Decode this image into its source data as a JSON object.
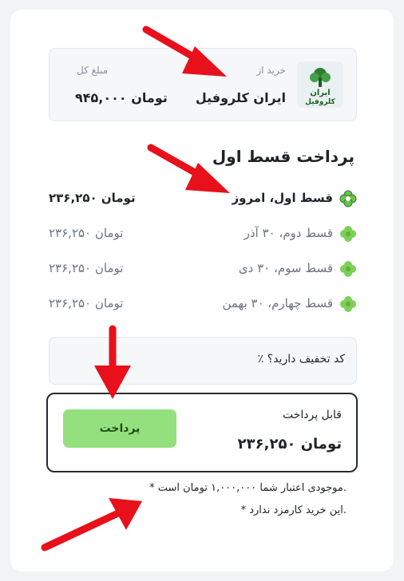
{
  "merchant": {
    "from_label": "خرید از",
    "name": "ایران کلروفیل",
    "total_label": "مبلغ کل",
    "total_amount": "۹۴۵,۰۰۰ تومان",
    "logo_text_top": "ایران",
    "logo_text_bottom": "کلروفیل"
  },
  "section_title": "پرداخت قسط اول",
  "installments": [
    {
      "label": "قسط اول، امروز",
      "amount": "۲۳۶,۲۵۰ تومان"
    },
    {
      "label": "قسط دوم، ۳۰ آذر",
      "amount": "۲۳۶,۲۵۰ تومان"
    },
    {
      "label": "قسط سوم، ۳۰ دی",
      "amount": "۲۳۶,۲۵۰ تومان"
    },
    {
      "label": "قسط چهارم، ۳۰ بهمن",
      "amount": "۲۳۶,۲۵۰ تومان"
    }
  ],
  "discount": {
    "label": "٪ کد تخفیف دارید؟"
  },
  "payment": {
    "payable_label": "قابل پرداخت",
    "payable_amount": "۲۳۶,۲۵۰ تومان",
    "pay_button": "پرداخت"
  },
  "notes": [
    "* موجودی اعتبار شما ۱,۰۰۰,۰۰۰ تومان است.",
    "* این خرید کارمزد ندارد."
  ],
  "colors": {
    "accent_green": "#94e07e",
    "leaf_green": "#6cc24a",
    "arrow_red": "#e8101a"
  }
}
